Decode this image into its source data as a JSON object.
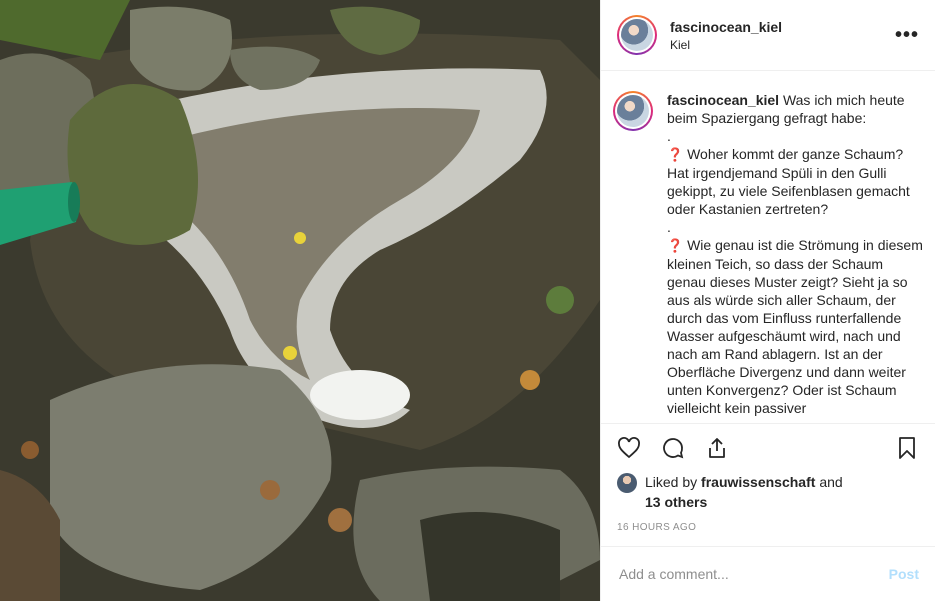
{
  "header": {
    "username": "fascinocean_kiel",
    "location": "Kiel",
    "more_icon": "more-horizontal-icon",
    "more_glyph": "•••"
  },
  "caption": {
    "username": "fascinocean_kiel",
    "intro": "Was ich mich heute beim Spaziergang gefragt habe:",
    "dot1": ".",
    "q1_mark": "❓",
    "q1_text": "Woher kommt der ganze Schaum? Hat irgendjemand Spüli in den Gulli gekippt, zu viele Seifenblasen gemacht oder Kastanien zertreten?",
    "dot2": ".",
    "q2_mark": "❓",
    "q2_text": "Wie genau ist die Strömung in diesem kleinen Teich, so dass der Schaum genau dieses Muster zeigt? Sieht ja so aus als würde sich aller Schaum, der durch das vom Einfluss runterfallende Wasser aufgeschäumt wird, nach und nach am Rand ablagern. Ist an der Oberfläche Divergenz und dann weiter unten Konvergenz? Oder ist Schaum vielleicht kein passiver"
  },
  "actions": {
    "like_icon": "heart-icon",
    "comment_icon": "comment-icon",
    "share_icon": "share-icon",
    "save_icon": "bookmark-icon"
  },
  "likes": {
    "prefix": "Liked by",
    "user": "frauwissenschaft",
    "and": "and",
    "others": "13 others"
  },
  "timestamp": "16 HOURS AGO",
  "comment": {
    "placeholder": "Add a comment...",
    "post_label": "Post"
  },
  "colors": {
    "post_button": "#b2dffc",
    "question_mark": "#d0021b",
    "ring_gradient": [
      "#f58529",
      "#dd2a7b",
      "#8134af"
    ]
  }
}
